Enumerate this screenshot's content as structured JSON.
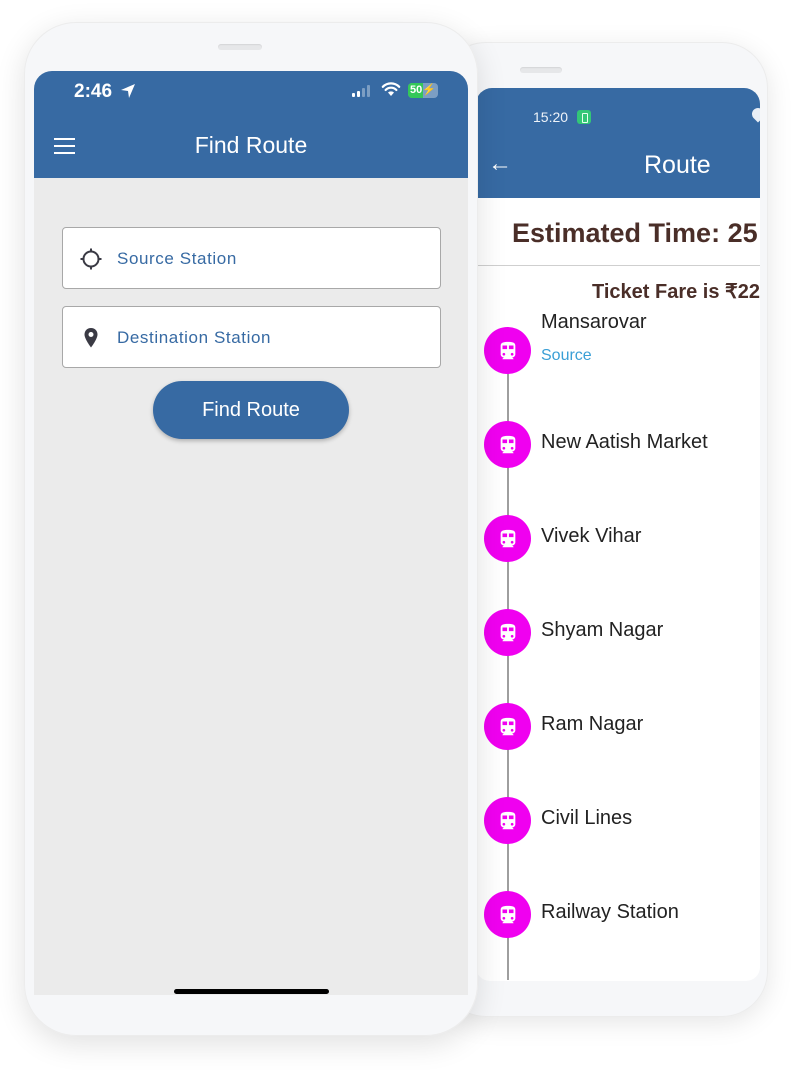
{
  "find_route_screen": {
    "status_bar": {
      "time": "2:46",
      "location_icon": "location-arrow-icon",
      "signal_bars": 4,
      "signal_active_bars": 2,
      "wifi_icon": "wifi-icon",
      "battery_label": "50",
      "battery_percent": 50,
      "battery_charging": true
    },
    "app_bar": {
      "menu_icon": "hamburger-menu-icon",
      "title": "Find Route"
    },
    "source_field": {
      "icon": "crosshair-icon",
      "placeholder": "Source Station"
    },
    "destination_field": {
      "icon": "map-pin-icon",
      "placeholder": "Destination Station"
    },
    "find_button_label": "Find Route"
  },
  "route_screen": {
    "status_bar": {
      "time": "15:20",
      "battery_saver_icon": "battery-saver-icon"
    },
    "app_bar": {
      "back_icon": "←",
      "title": "Route"
    },
    "estimated_time_text": "Estimated Time: 25",
    "ticket_fare_text": "Ticket Fare is ₹22",
    "stations": [
      {
        "name": "Mansarovar",
        "tag": "Source"
      },
      {
        "name": "New Aatish Market",
        "tag": ""
      },
      {
        "name": "Vivek Vihar",
        "tag": ""
      },
      {
        "name": "Shyam Nagar",
        "tag": ""
      },
      {
        "name": "Ram Nagar",
        "tag": ""
      },
      {
        "name": "Civil Lines",
        "tag": ""
      },
      {
        "name": "Railway Station",
        "tag": ""
      }
    ]
  },
  "colors": {
    "primary": "#376aa3",
    "station_marker": "#f000f0",
    "heading_text": "#4a2e28",
    "source_tag": "#3a9fd6",
    "battery_green": "#34c759"
  }
}
